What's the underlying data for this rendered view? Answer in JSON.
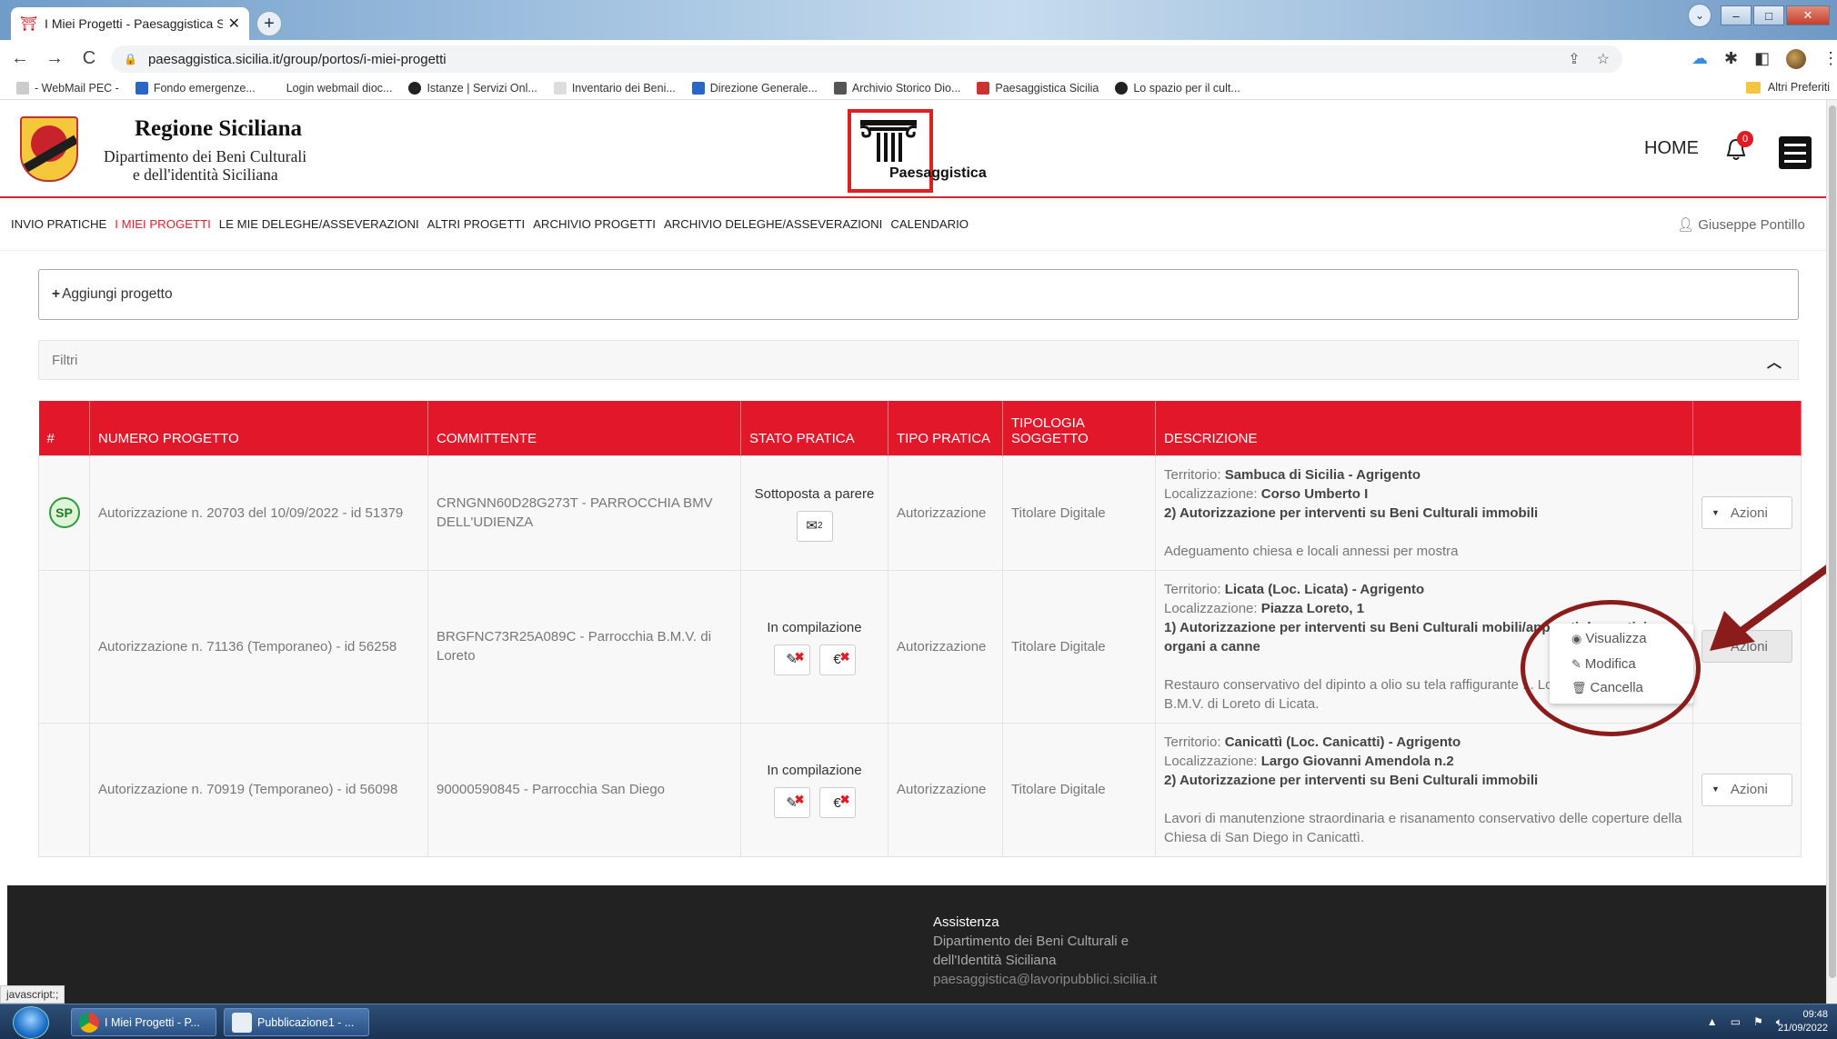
{
  "browser": {
    "tab_title": "I Miei Progetti - Paesaggistica Sic",
    "url": "paesaggistica.sicilia.it/group/portos/i-miei-progetti",
    "bookmarks": [
      "- WebMail PEC -",
      "Fondo emergenze...",
      "Login webmail dioc...",
      "Istanze | Servizi Onl...",
      "Inventario dei Beni...",
      "Direzione Generale...",
      "Archivio Storico Dio...",
      "Paesaggistica Sicilia",
      "Lo spazio per il cult..."
    ],
    "bookmarks_other": "Altri Preferiti"
  },
  "header": {
    "region_name": "Regione Siciliana",
    "dept_line1": "Dipartimento dei Beni Culturali",
    "dept_line2": "e dell'identità Siciliana",
    "logo_text": "Paesaggistica",
    "home": "HOME",
    "notifications": "0"
  },
  "nav": {
    "items": [
      "INVIO PRATICHE",
      "I MIEI PROGETTI",
      "LE MIE DELEGHE/ASSEVERAZIONI",
      "ALTRI PROGETTI",
      "ARCHIVIO PROGETTI",
      "ARCHIVIO DELEGHE/ASSEVERAZIONI",
      "CALENDARIO"
    ],
    "active": "I MIEI PROGETTI",
    "user": "Giuseppe Pontillo"
  },
  "panels": {
    "add_project": "Aggiungi progetto",
    "filters": "Filtri"
  },
  "table": {
    "headers": [
      "#",
      "NUMERO PROGETTO",
      "COMMITTENTE",
      "STATO PRATICA",
      "TIPO PRATICA",
      "TIPOLOGIA SOGGETTO",
      "DESCRIZIONE",
      ""
    ],
    "territorio_label": "Territorio:",
    "localizzazione_label": "Localizzazione:",
    "actions_label": "Azioni",
    "rows": [
      {
        "badge": "SP",
        "numero": "Autorizzazione n. 20703 del 10/09/2022 - id 51379",
        "committente": "CRNGNN60D28G273T - PARROCCHIA BMV DELL'UDIENZA",
        "stato": "Sottoposta a parere",
        "mail_count": "2",
        "tipo": "Autorizzazione",
        "soggetto": "Titolare Digitale",
        "territorio": "Sambuca di Sicilia - Agrigento",
        "localizzazione": "Corso Umberto I",
        "intervento": "2) Autorizzazione per interventi su Beni Culturali immobili",
        "descrizione": "Adeguamento chiesa e locali annessi per mostra"
      },
      {
        "badge": "",
        "numero": "Autorizzazione n. 71136 (Temporaneo) - id 56258",
        "committente": "BRGFNC73R25A089C - Parrocchia B.M.V. di Loreto",
        "stato": "In compilazione",
        "tipo": "Autorizzazione",
        "soggetto": "Titolare Digitale",
        "territorio": "Licata (Loc. Licata) - Agrigento",
        "localizzazione": "Piazza Loreto, 1",
        "intervento": "1) Autorizzazione per interventi su Beni Culturali mobili/apparati decorativi, organi a canne",
        "descrizione": "Restauro conservativo del dipinto a olio su tela raffigurante ... Loreto. Parrocchia B.M.V. di Loreto di Licata."
      },
      {
        "badge": "",
        "numero": "Autorizzazione n. 70919 (Temporaneo) - id 56098",
        "committente": "90000590845 - Parrocchia San Diego",
        "stato": "In compilazione",
        "tipo": "Autorizzazione",
        "soggetto": "Titolare Digitale",
        "territorio": "Canicattì (Loc. Canicatti) - Agrigento",
        "localizzazione": "Largo Giovanni Amendola n.2",
        "intervento": "2) Autorizzazione per interventi su Beni Culturali immobili",
        "descrizione": "Lavori di manutenzione straordinaria e risanamento conservativo delle coperture della Chiesa di San Diego in Canicattì."
      }
    ]
  },
  "dropdown": {
    "items": [
      "Visualizza",
      "Modifica",
      "Cancella"
    ]
  },
  "footer": {
    "title": "Assistenza",
    "line1": "Dipartimento dei Beni Culturali e",
    "line2": "dell'Identità Siciliana",
    "email": "paesaggistica@lavoripubblici.sicilia.it"
  },
  "status_bar": "javascript:;",
  "taskbar": {
    "items": [
      "I Miei Progetti - P...",
      "Pubblicazione1 - ..."
    ],
    "time": "09:48",
    "date": "21/09/2022"
  },
  "colors": {
    "accent_red": "#e3172a",
    "annotation": "#8b1c1c",
    "footer_bg": "#222222"
  }
}
